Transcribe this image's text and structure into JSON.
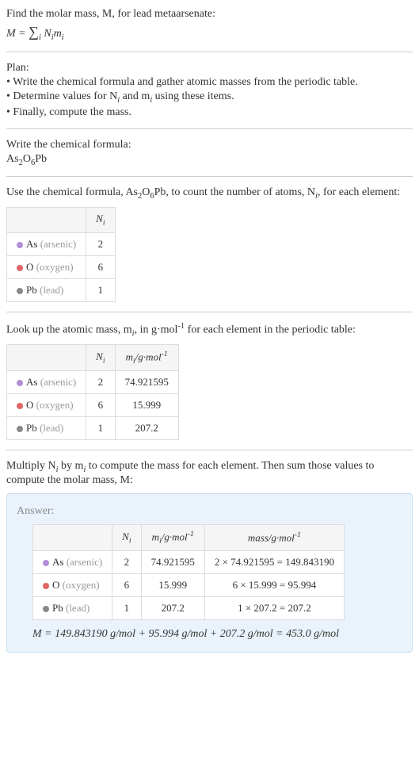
{
  "intro": {
    "line1": "Find the molar mass, M, for lead metaarsenate:",
    "formula_lhs": "M = ",
    "formula_sum": "∑",
    "formula_sub": "i",
    "formula_rhs": " N",
    "formula_i1": "i",
    "formula_m": "m",
    "formula_i2": "i"
  },
  "plan": {
    "title": "Plan:",
    "b1": "• Write the chemical formula and gather atomic masses from the periodic table.",
    "b2_a": "• Determine values for N",
    "b2_b": " and m",
    "b2_c": " using these items.",
    "b3": "• Finally, compute the mass."
  },
  "chemformula": {
    "title": "Write the chemical formula:",
    "f_as": "As",
    "f_as_n": "2",
    "f_o": "O",
    "f_o_n": "6",
    "f_pb": "Pb"
  },
  "count": {
    "line_a": "Use the chemical formula, As",
    "line_b": "O",
    "line_c": "Pb, to count the number of atoms, N",
    "line_d": ", for each element:",
    "hdr_n": "N",
    "rows": [
      {
        "color": "#b48ed6",
        "sym": "As",
        "name": "(arsenic)",
        "n": "2"
      },
      {
        "color": "#e06666",
        "sym": "O",
        "name": "(oxygen)",
        "n": "6"
      },
      {
        "color": "#888888",
        "sym": "Pb",
        "name": "(lead)",
        "n": "1"
      }
    ]
  },
  "lookup": {
    "line_a": "Look up the atomic mass, m",
    "line_b": ", in g·mol",
    "line_c": " for each element in the periodic table:",
    "hdr_m": "m",
    "hdr_unit": "/g·mol",
    "rows": [
      {
        "color": "#b48ed6",
        "sym": "As",
        "name": "(arsenic)",
        "n": "2",
        "m": "74.921595"
      },
      {
        "color": "#e06666",
        "sym": "O",
        "name": "(oxygen)",
        "n": "6",
        "m": "15.999"
      },
      {
        "color": "#888888",
        "sym": "Pb",
        "name": "(lead)",
        "n": "1",
        "m": "207.2"
      }
    ]
  },
  "multiply": {
    "line_a": "Multiply N",
    "line_b": " by m",
    "line_c": " to compute the mass for each element. Then sum those values to compute the molar mass, M:"
  },
  "answer": {
    "label": "Answer:",
    "hdr_mass": "mass/g·mol",
    "rows": [
      {
        "color": "#b48ed6",
        "sym": "As",
        "name": "(arsenic)",
        "n": "2",
        "m": "74.921595",
        "calc": "2 × 74.921595 = 149.843190"
      },
      {
        "color": "#e06666",
        "sym": "O",
        "name": "(oxygen)",
        "n": "6",
        "m": "15.999",
        "calc": "6 × 15.999 = 95.994"
      },
      {
        "color": "#888888",
        "sym": "Pb",
        "name": "(lead)",
        "n": "1",
        "m": "207.2",
        "calc": "1 × 207.2 = 207.2"
      }
    ],
    "final": "M = 149.843190 g/mol + 95.994 g/mol + 207.2 g/mol = 453.0 g/mol"
  },
  "i": "i",
  "neg1": "-1",
  "two": "2",
  "six": "6"
}
